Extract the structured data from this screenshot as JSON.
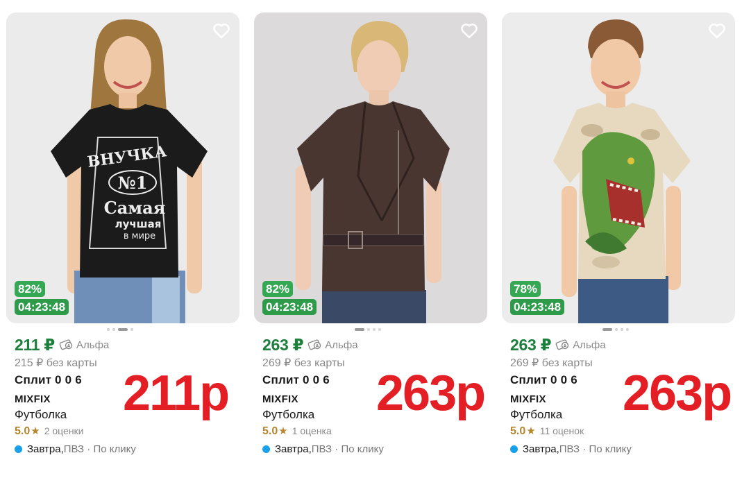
{
  "products": [
    {
      "discount": "82%",
      "timer": "04:23:48",
      "price": "211 ₽",
      "payment_label": "Альфа",
      "old_price": "215 ₽ без карты",
      "split": "Сплит 0 0 6",
      "brand": "MIXFIX",
      "type": "Футболка",
      "rating": "5.0",
      "rating_count": "2 оценки",
      "delivery_main": "Завтра,",
      "delivery_rest": " ПВЗ · По клику",
      "annotation": "211р",
      "shirt_text": [
        "ВНУЧКА",
        "№1",
        "Самая",
        "лучшая",
        "в мире"
      ],
      "shirt_color": "#1b1b1b",
      "bg_color": "#ebebeb"
    },
    {
      "discount": "82%",
      "timer": "04:23:48",
      "price": "263 ₽",
      "payment_label": "Альфа",
      "old_price": "269 ₽ без карты",
      "split": "Сплит 0 0 6",
      "brand": "MIXFIX",
      "type": "Футболка",
      "rating": "5.0",
      "rating_count": "1 оценка",
      "delivery_main": "Завтра,",
      "delivery_rest": " ПВЗ · По клику",
      "annotation": "263р",
      "shirt_color": "#4a3631",
      "bg_color": "#dcdadb"
    },
    {
      "discount": "78%",
      "timer": "04:23:48",
      "price": "263 ₽",
      "payment_label": "Альфа",
      "old_price": "269 ₽ без карты",
      "split": "Сплит 0 0 6",
      "brand": "MIXFIX",
      "type": "Футболка",
      "rating": "5.0",
      "rating_count": "11 оценок",
      "delivery_main": "Завтра,",
      "delivery_rest": " ПВЗ · По клику",
      "annotation": "263р",
      "shirt_color": "#e6d9bf",
      "bg_color": "#ececec"
    }
  ],
  "colors": {
    "price_green": "#1d7f3c",
    "badge_green": "#34a853",
    "rating_gold": "#b5862e",
    "delivery_blue": "#18a0ea",
    "annotation_red": "#e31e24"
  }
}
